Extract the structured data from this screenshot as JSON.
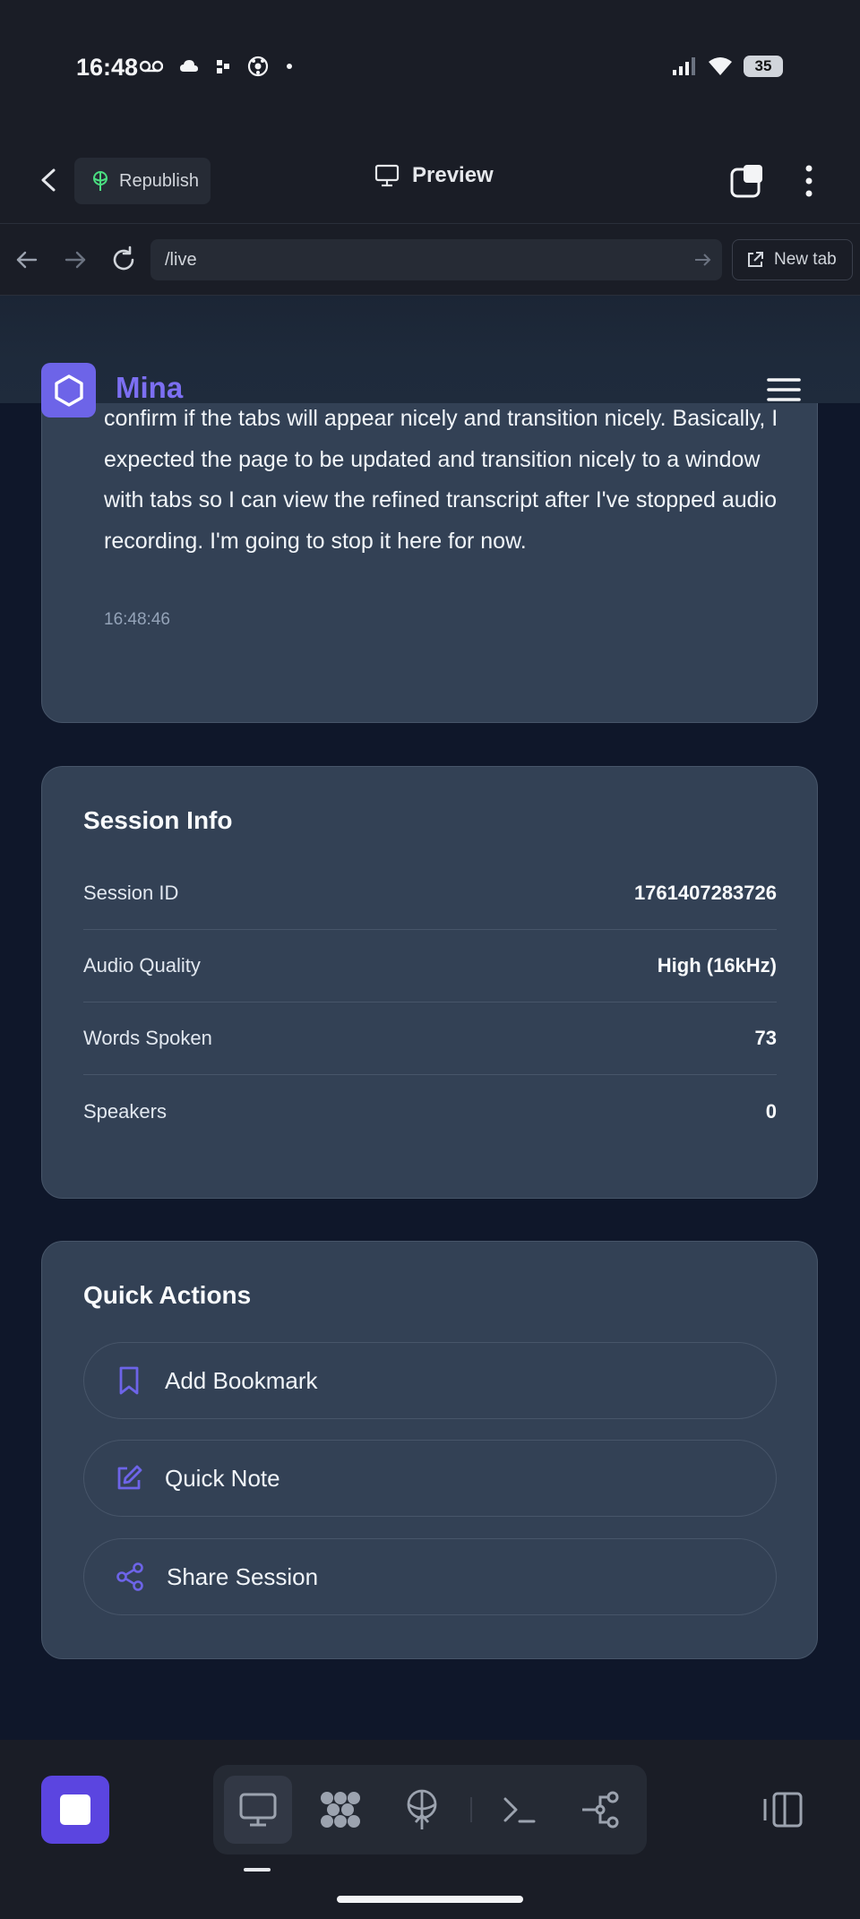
{
  "status_bar": {
    "time": "16:48",
    "battery": "35",
    "left_icons": [
      "voicemail-icon",
      "weather-icon",
      "app-icon",
      "soccer-icon",
      "dot-icon"
    ],
    "right_icons": [
      "signal-icon",
      "wifi-icon",
      "battery-icon"
    ]
  },
  "app_bar": {
    "republish_label": "Republish",
    "preview_label": "Preview"
  },
  "browser": {
    "url": "/live",
    "new_tab_label": "New tab"
  },
  "site": {
    "brand": "Mina"
  },
  "transcript": {
    "text": "confirm if the tabs will appear nicely and transition nicely. Basically, I expected the page to be updated and transition nicely to a window with tabs so I can view the refined transcript after I've stopped audio recording. I'm going to stop it here for now.",
    "timestamp": "16:48:46"
  },
  "session_info": {
    "title": "Session Info",
    "rows": [
      {
        "label": "Session ID",
        "value": "1761407283726"
      },
      {
        "label": "Audio Quality",
        "value": "High (16kHz)"
      },
      {
        "label": "Words Spoken",
        "value": "73"
      },
      {
        "label": "Speakers",
        "value": "0"
      }
    ]
  },
  "quick_actions": {
    "title": "Quick Actions",
    "items": [
      {
        "label": "Add Bookmark",
        "icon": "bookmark-icon"
      },
      {
        "label": "Quick Note",
        "icon": "edit-icon"
      },
      {
        "label": "Share Session",
        "icon": "share-icon"
      }
    ]
  },
  "dock": {
    "items": [
      "desktop-icon",
      "apps-icon",
      "deploy-icon",
      "terminal-icon",
      "git-icon"
    ],
    "active": "desktop-icon"
  },
  "colors": {
    "accent": "#6d64e8",
    "brand_text": "#7c6ff2",
    "card_bg": "#334155",
    "page_bg": "#0f172a",
    "stop_button": "#5b45e0"
  }
}
